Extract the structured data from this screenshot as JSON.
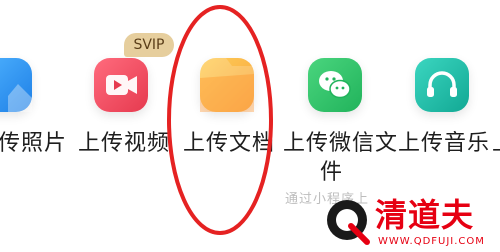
{
  "items": [
    {
      "label": "传照片",
      "icon": "photo-icon",
      "color": "#2f97f1"
    },
    {
      "label": "上传视频",
      "icon": "video-camera-icon",
      "color": "#ef4f61"
    },
    {
      "label": "上传文档",
      "icon": "document-folder-icon",
      "color": "#f8a23c"
    },
    {
      "label": "上传微信文",
      "label_line2": "件",
      "icon": "wechat-icon",
      "color": "#33c36b"
    },
    {
      "label": "上传音乐",
      "icon": "headphones-icon",
      "color": "#23bda7"
    },
    {
      "label": "上"
    }
  ],
  "badge": {
    "text": "SVIP"
  },
  "hint_text": "通过小程序上",
  "annotation": {
    "color": "#e52222"
  },
  "watermark": {
    "brand": "清道夫",
    "url": "WWW.QDFUJI.COM",
    "color": "#e60012"
  }
}
